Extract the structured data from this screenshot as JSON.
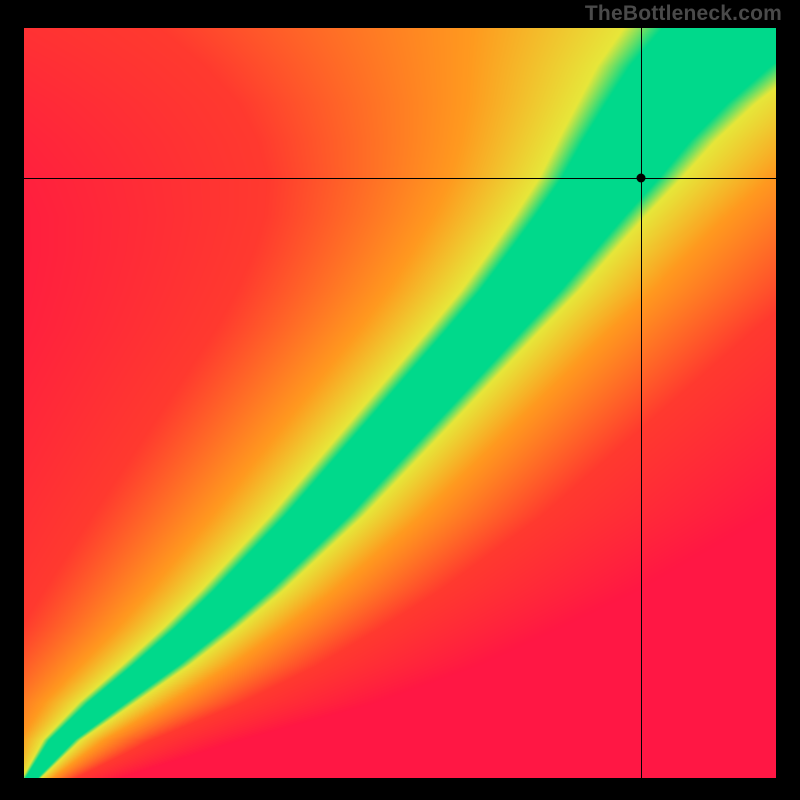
{
  "watermark": "TheBottleneck.com",
  "chart_data": {
    "type": "heatmap",
    "title": "",
    "xlabel": "",
    "ylabel": "",
    "xlim": [
      0,
      1
    ],
    "ylim": [
      0,
      1
    ],
    "grid": false,
    "legend": false,
    "marker": {
      "x": 0.82,
      "y": 0.8
    },
    "crosshair": {
      "x": 0.82,
      "y": 0.8
    },
    "ridge": {
      "description": "Green optimal band; x is a monotone function of y with a mild S-curve. Points are (y, x_center, half_width).",
      "points": [
        [
          0.0,
          0.01,
          0.01
        ],
        [
          0.05,
          0.05,
          0.02
        ],
        [
          0.1,
          0.11,
          0.03
        ],
        [
          0.15,
          0.175,
          0.036
        ],
        [
          0.2,
          0.235,
          0.04
        ],
        [
          0.25,
          0.29,
          0.044
        ],
        [
          0.3,
          0.34,
          0.047
        ],
        [
          0.35,
          0.39,
          0.05
        ],
        [
          0.4,
          0.435,
          0.052
        ],
        [
          0.45,
          0.48,
          0.054
        ],
        [
          0.5,
          0.525,
          0.056
        ],
        [
          0.55,
          0.57,
          0.058
        ],
        [
          0.6,
          0.615,
          0.06
        ],
        [
          0.65,
          0.66,
          0.063
        ],
        [
          0.7,
          0.7,
          0.066
        ],
        [
          0.75,
          0.74,
          0.07
        ],
        [
          0.8,
          0.78,
          0.076
        ],
        [
          0.85,
          0.815,
          0.084
        ],
        [
          0.9,
          0.855,
          0.095
        ],
        [
          0.95,
          0.9,
          0.11
        ],
        [
          1.0,
          0.96,
          0.13
        ]
      ]
    },
    "colors": {
      "optimal": "#00d98b",
      "near": "#e7e73a",
      "mid": "#ff9a1f",
      "far": "#ff3a2f",
      "worst": "#ff1744"
    }
  }
}
